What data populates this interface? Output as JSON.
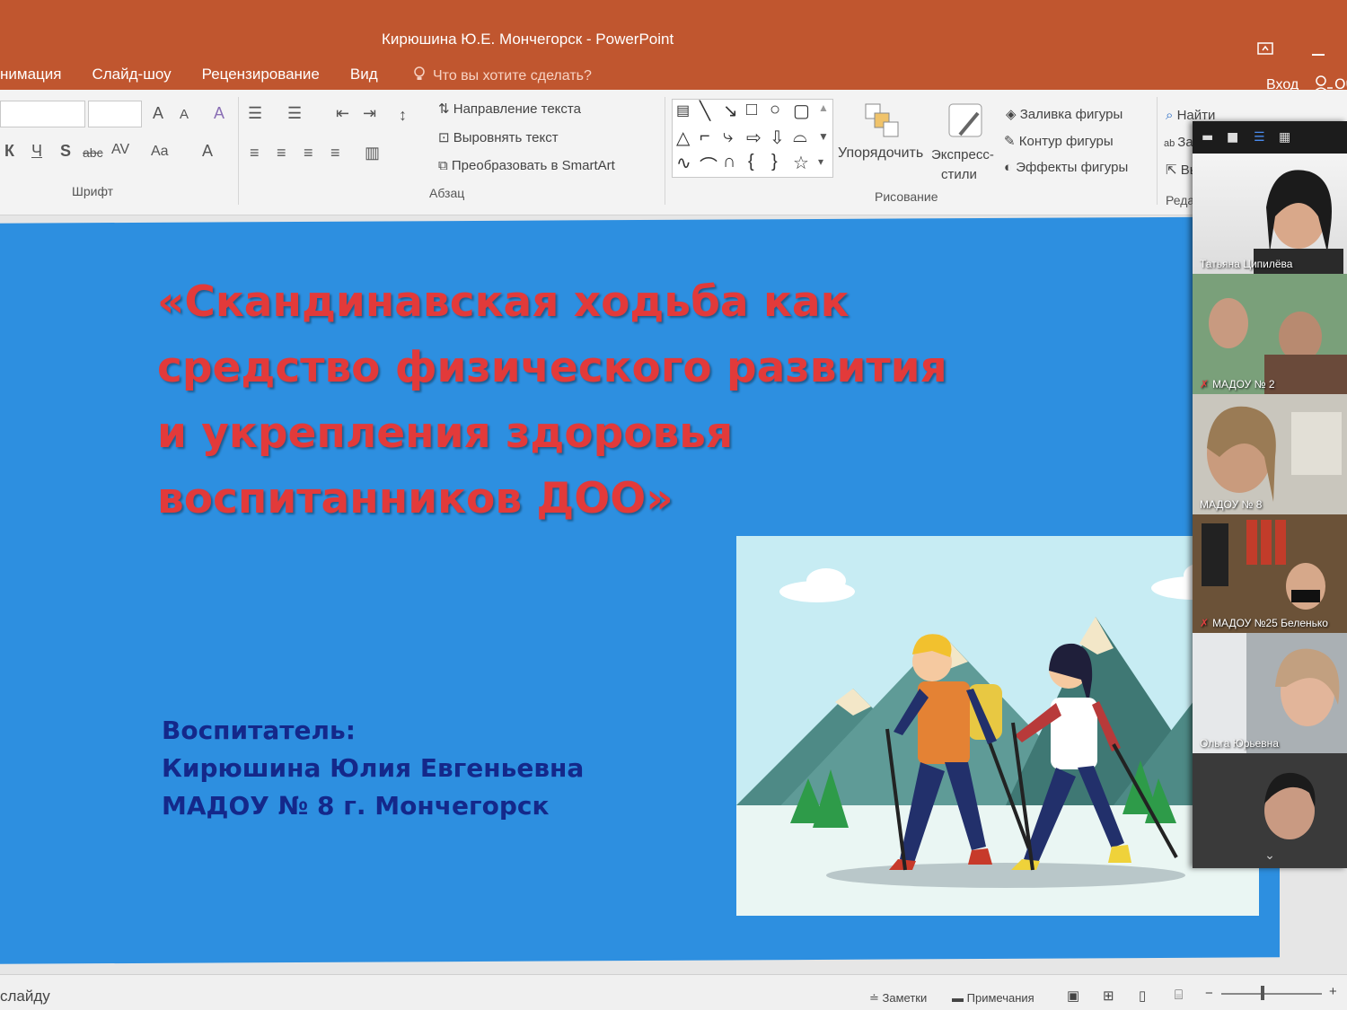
{
  "window": {
    "title": "Кирюшина Ю.Е. Мончегорск - PowerPoint",
    "restore_icon": "restore-icon",
    "minimize_icon": "minimize-icon"
  },
  "tabs": [
    "нимация",
    "Слайд-шоу",
    "Рецензирование",
    "Вид"
  ],
  "tell_me": {
    "icon": "lightbulb-icon",
    "placeholder": "Что вы хотите сделать?"
  },
  "account": {
    "signin": "Вход",
    "share_icon": "person-icon",
    "share_partial": "Об"
  },
  "ribbon": {
    "font_group": {
      "label": "Шрифт",
      "grow": "A",
      "shrink": "A",
      "bold": "К",
      "italic": "Ч",
      "underline": "S",
      "strike": "abc",
      "spacing": "AV",
      "case": "Aa",
      "color": "A"
    },
    "paragraph_group": {
      "label": "Абзац",
      "text_direction": "Направление текста",
      "align_text": "Выровнять текст",
      "smartart": "Преобразовать в SmartArt"
    },
    "drawing_group": {
      "label": "Рисование",
      "arrange": "Упорядочить",
      "quick_styles_line1": "Экспресс-",
      "quick_styles_line2": "стили",
      "fill": "Заливка фигуры",
      "outline": "Контур фигуры",
      "effects": "Эффекты фигуры"
    },
    "editing_group": {
      "label": "Редакти",
      "find": "Найти",
      "replace": "Заме",
      "select": "Выде"
    }
  },
  "slide": {
    "title": "«Скандинавская ходьба как средство физического развития и укрепления здоровья воспитанников ДОО»",
    "author_line1": "Воспитатель:",
    "author_line2": "Кирюшина Юлия Евгеньевна",
    "author_line3": "МАДОУ № 8 г. Мончегорск",
    "accent_title": "#e23a3a",
    "accent_author": "#14288a",
    "background": "#2d8fe0"
  },
  "statusbar": {
    "left": "слайду",
    "notes": "Заметки",
    "comments": "Примечания"
  },
  "video_panel": {
    "participants": [
      {
        "name": "Татьяна Ципилёва",
        "muted": false
      },
      {
        "name": "МАДОУ № 2",
        "muted": true
      },
      {
        "name": "МАДОУ № 8",
        "muted": false
      },
      {
        "name": "МАДОУ №25 Беленько",
        "muted": true
      },
      {
        "name": "Ольга Юрьевна",
        "muted": false
      },
      {
        "name": "",
        "muted": false
      }
    ]
  }
}
